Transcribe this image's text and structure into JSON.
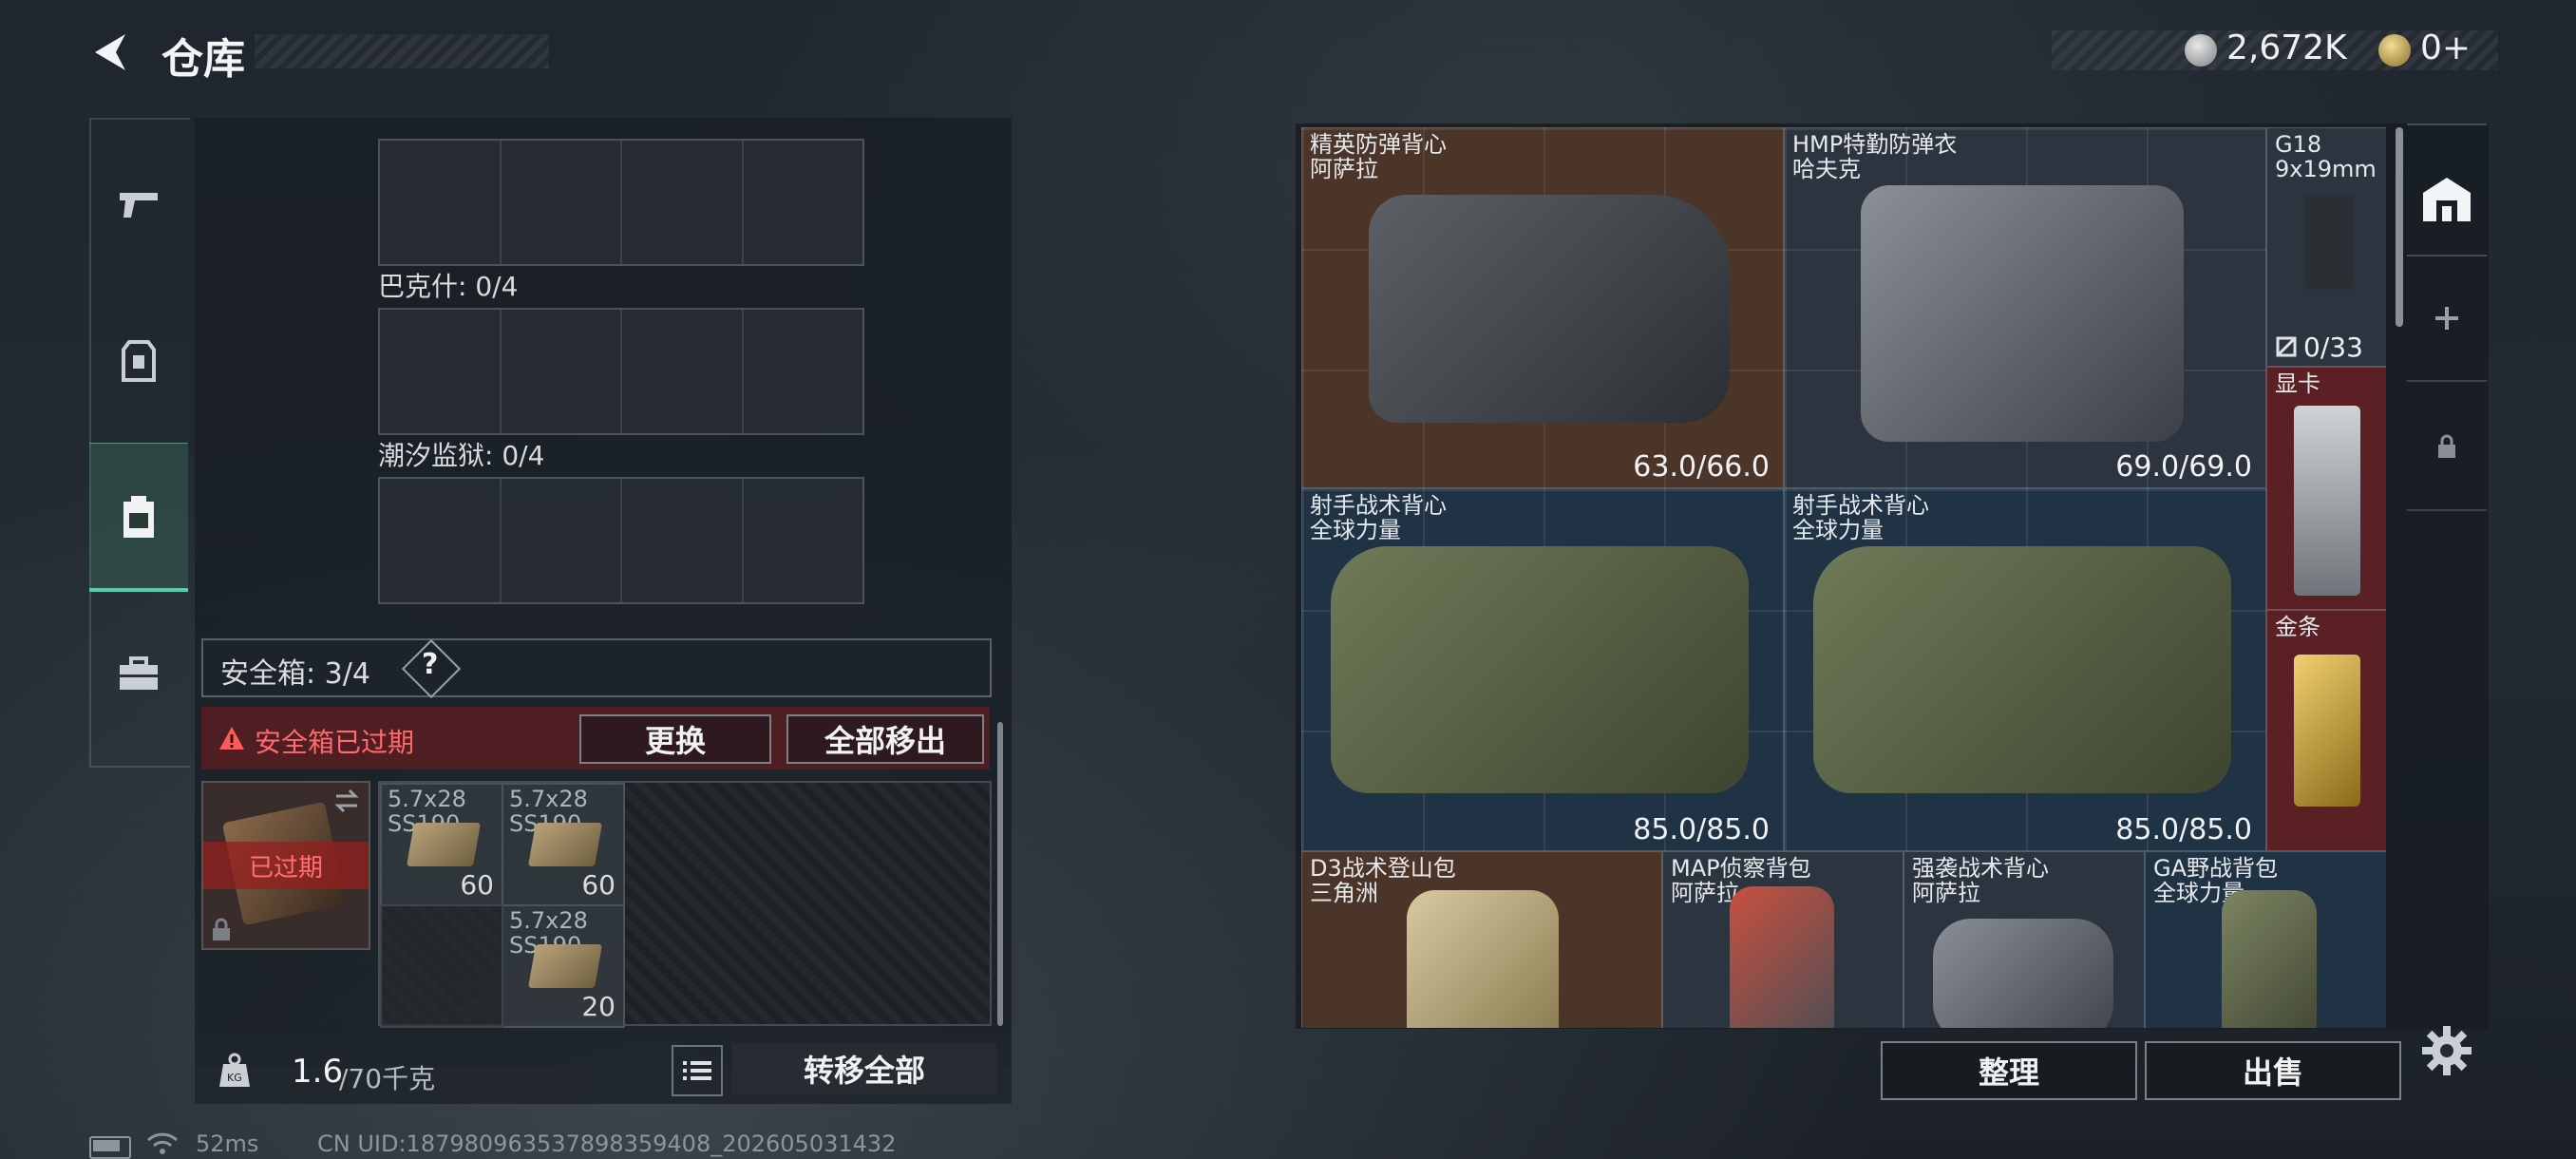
{
  "header": {
    "title": "仓库"
  },
  "currency": {
    "coins": "2,672K",
    "premium": "0+"
  },
  "side_nav": {
    "items": [
      "weapons",
      "equipment",
      "backpack",
      "toolbox"
    ]
  },
  "storage_groups": [
    {
      "label": ""
    },
    {
      "label": "巴克什: 0/4"
    },
    {
      "label": "潮汐监狱: 0/4"
    }
  ],
  "safebox": {
    "label": "安全箱: 3/4",
    "help": "?"
  },
  "expired": {
    "warning": "安全箱已过期",
    "replace_button": "更换",
    "move_all_button": "全部移出",
    "case_badge": "已过期"
  },
  "ammo": [
    {
      "name1": "5.7x28",
      "name2": "SS190",
      "qty": "60"
    },
    {
      "name1": "5.7x28",
      "name2": "SS190",
      "qty": "60"
    },
    {
      "name1": "5.7x28",
      "name2": "SS190",
      "qty": "20"
    }
  ],
  "weight": {
    "current": "1.6",
    "max": "/70千克",
    "transfer_all": "转移全部"
  },
  "items": [
    {
      "line1": "精英防弹背心",
      "line2": "阿萨拉",
      "dur": "63.0/66.0"
    },
    {
      "line1": "HMP特勤防弹衣",
      "line2": "哈夫克",
      "dur": "69.0/69.0"
    },
    {
      "line1": "G18",
      "line2": "9x19mm",
      "ammo": "0/33"
    },
    {
      "line1": "显卡"
    },
    {
      "line1": "射手战术背心",
      "line2": "全球力量",
      "dur": "85.0/85.0"
    },
    {
      "line1": "射手战术背心",
      "line2": "全球力量",
      "dur": "85.0/85.0"
    },
    {
      "line1": "金条"
    },
    {
      "line1": "D3战术登山包",
      "line2": "三角洲"
    },
    {
      "line1": "MAP侦察背包",
      "line2": "阿萨拉"
    },
    {
      "line1": "强袭战术背心",
      "line2": "阿萨拉"
    },
    {
      "line1": "GA野战背包",
      "line2": "全球力量"
    }
  ],
  "actions": {
    "sort": "整理",
    "sell": "出售"
  },
  "status": {
    "ping": "52ms",
    "uid": "CN UID:18798096353789835940​8_202605031432"
  },
  "colors": {
    "accent": "#4fd1a6",
    "danger": "#e04545",
    "expired_bg": "#781c1e"
  }
}
